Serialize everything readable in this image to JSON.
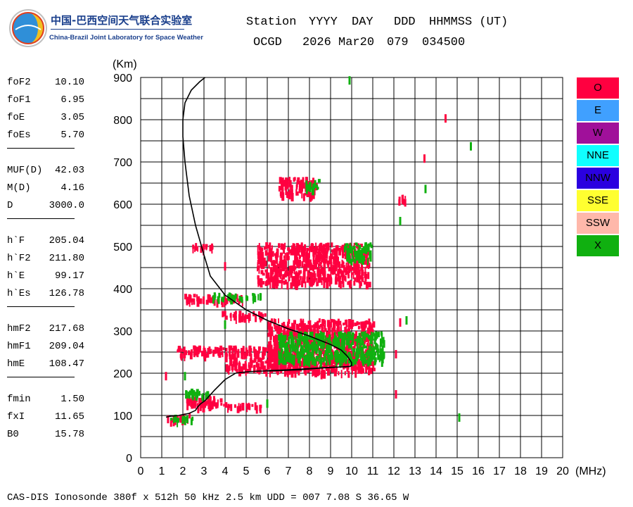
{
  "logo": {
    "cn": "中国-巴西空间天气联合实验室",
    "en": "China-Brazil Joint Laboratory for Space Weather"
  },
  "header": {
    "station_label": "Station",
    "yyyy_label": "YYYY",
    "day_label": "DAY",
    "ddd_label": "DDD",
    "hhmmss_label": "HHMMSS (UT)",
    "station": "OCGD",
    "date": "2026 Mar20",
    "doy": "079",
    "time": "034500"
  },
  "params": [
    {
      "name": "foF2",
      "value": "10.10"
    },
    {
      "name": "foF1",
      "value": "6.95"
    },
    {
      "name": "foE",
      "value": "3.05"
    },
    {
      "name": "foEs",
      "value": "5.70"
    },
    {
      "name": "MUF(D)",
      "value": "42.03"
    },
    {
      "name": "M(D)",
      "value": "4.16"
    },
    {
      "name": "D",
      "value": "3000.0"
    },
    {
      "name": "h`F",
      "value": "205.04"
    },
    {
      "name": "h`F2",
      "value": "211.80"
    },
    {
      "name": "h`E",
      "value": "99.17"
    },
    {
      "name": "h`Es",
      "value": "126.78"
    },
    {
      "name": "hmF2",
      "value": "217.68"
    },
    {
      "name": "hmF1",
      "value": "209.04"
    },
    {
      "name": "hmE",
      "value": "108.47"
    },
    {
      "name": "fmin",
      "value": "1.50"
    },
    {
      "name": "fxI",
      "value": "11.65"
    },
    {
      "name": "B0",
      "value": "15.78"
    }
  ],
  "legend": [
    {
      "label": "O",
      "color": "#ff0040"
    },
    {
      "label": "E",
      "color": "#40a0ff"
    },
    {
      "label": "W",
      "color": "#a0109a"
    },
    {
      "label": "NNE",
      "color": "#10ffff"
    },
    {
      "label": "NNW",
      "color": "#2a00e0"
    },
    {
      "label": "SSE",
      "color": "#ffff30"
    },
    {
      "label": "SSW",
      "color": "#ffb8aa"
    },
    {
      "label": "X",
      "color": "#10b010"
    }
  ],
  "footer": "CAS-DIS Ionosonde 380f x 512h 50 kHz 2.5 km UDD = 007 7.08 S 36.65 W",
  "chart_data": {
    "type": "scatter",
    "title": "",
    "xlabel": "(MHz)",
    "ylabel": "(Km)",
    "xlim": [
      0,
      20
    ],
    "ylim": [
      0,
      900
    ],
    "xticks": [
      0,
      1,
      2,
      3,
      4,
      5,
      6,
      7,
      8,
      9,
      10,
      11,
      12,
      13,
      14,
      15,
      16,
      17,
      18,
      19,
      20
    ],
    "yticks": [
      0,
      100,
      200,
      300,
      400,
      500,
      600,
      700,
      800,
      900
    ],
    "grid": true,
    "series": [
      {
        "name": "O",
        "color": "#ff0040",
        "clusters": [
          {
            "f": [
              2.0,
              3.8
            ],
            "h": [
              130,
              150
            ]
          },
          {
            "f": [
              1.2,
              2.3
            ],
            "h": [
              92,
              105
            ]
          },
          {
            "f": [
              2.6,
              5.7
            ],
            "h": [
              122,
              132
            ]
          },
          {
            "f": [
              1.7,
              6.3
            ],
            "h": [
              244,
              266
            ]
          },
          {
            "f": [
              4.0,
              6.5
            ],
            "h": [
              208,
              238
            ]
          },
          {
            "f": [
              6.0,
              11.0
            ],
            "h": [
              205,
              330
            ]
          },
          {
            "f": [
              2.0,
              4.9
            ],
            "h": [
              373,
              388
            ]
          },
          {
            "f": [
              3.8,
              5.9
            ],
            "h": [
              335,
              348
            ]
          },
          {
            "f": [
              5.5,
              10.8
            ],
            "h": [
              415,
              510
            ]
          },
          {
            "f": [
              2.4,
              3.4
            ],
            "h": [
              497,
              510
            ]
          },
          {
            "f": [
              6.5,
              8.3
            ],
            "h": [
              625,
              665
            ]
          },
          {
            "f": [
              12.2,
              12.6
            ],
            "h": [
              610,
              625
            ]
          }
        ],
        "points": [
          {
            "f": 13.45,
            "h": 708
          },
          {
            "f": 14.45,
            "h": 803
          },
          {
            "f": 12.1,
            "h": 150
          },
          {
            "f": 12.1,
            "h": 245
          },
          {
            "f": 12.3,
            "h": 320
          },
          {
            "f": 1.2,
            "h": 193
          },
          {
            "f": 4.0,
            "h": 453
          },
          {
            "f": 8.7,
            "h": 453
          }
        ]
      },
      {
        "name": "X",
        "color": "#10b010",
        "clusters": [
          {
            "f": [
              2.0,
              3.2
            ],
            "h": [
              150,
              165
            ]
          },
          {
            "f": [
              1.4,
              2.5
            ],
            "h": [
              92,
              102
            ]
          },
          {
            "f": [
              6.5,
              11.5
            ],
            "h": [
              230,
              300
            ]
          },
          {
            "f": [
              9.6,
              11.0
            ],
            "h": [
              470,
              510
            ]
          },
          {
            "f": [
              3.4,
              5.7
            ],
            "h": [
              380,
              392
            ]
          },
          {
            "f": [
              7.8,
              8.4
            ],
            "h": [
              640,
              660
            ]
          }
        ],
        "points": [
          {
            "f": 9.9,
            "h": 893
          },
          {
            "f": 15.65,
            "h": 737
          },
          {
            "f": 13.5,
            "h": 636
          },
          {
            "f": 12.3,
            "h": 560
          },
          {
            "f": 15.1,
            "h": 95
          },
          {
            "f": 12.6,
            "h": 325
          },
          {
            "f": 6.0,
            "h": 128
          },
          {
            "f": 2.1,
            "h": 193
          },
          {
            "f": 4.0,
            "h": 315
          }
        ]
      }
    ],
    "profile_curve": {
      "f": [
        6.0,
        7.5,
        8.5,
        9.2,
        9.6,
        9.9,
        10.0,
        10.0,
        9.8,
        9.5,
        9.0,
        8.0,
        7.0,
        6.0,
        5.0,
        4.0,
        3.3,
        3.0,
        2.6,
        2.3,
        2.1,
        2.0,
        2.0,
        2.1,
        2.4,
        2.8,
        3.05
      ],
      "h": [
        205,
        208,
        212,
        214,
        215,
        216,
        218,
        225,
        240,
        255,
        268,
        288,
        305,
        325,
        350,
        385,
        430,
        480,
        550,
        620,
        700,
        760,
        800,
        840,
        870,
        890,
        900
      ]
    },
    "trace_curve": {
      "f": [
        1.2,
        1.4,
        1.8,
        2.3,
        2.6,
        2.7,
        2.85,
        3.05,
        3.5,
        4.0,
        4.5,
        4.8,
        5.0,
        5.3,
        5.6,
        5.8,
        6.0,
        7.0,
        8.0,
        9.0,
        9.6,
        9.9,
        10.0,
        10.0
      ],
      "h": [
        96,
        98,
        100,
        105,
        112,
        120,
        128,
        135,
        160,
        185,
        200,
        202,
        203,
        204,
        205,
        205,
        206,
        208,
        211,
        214,
        215,
        216,
        218,
        222
      ]
    }
  }
}
